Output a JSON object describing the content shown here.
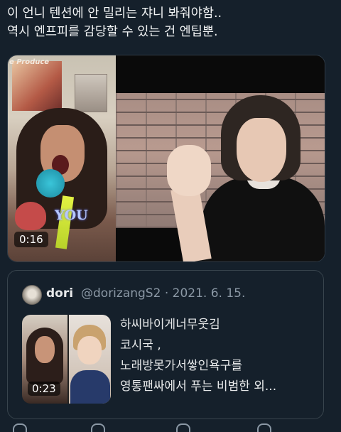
{
  "tweet": {
    "lines": [
      "이 언니 텐션에 안 밀리는 쟈니 봐줘야함..",
      "역시 엔프피를 감당할 수 있는 건 엔팁뿐."
    ]
  },
  "video": {
    "duration": "0:16",
    "overlay_text": "e Produce",
    "sticker_text": "YOU"
  },
  "quote": {
    "name": "dori",
    "handle_date": "@dorizangS2 · 2021. 6. 15.",
    "thumb_duration": "0:23",
    "text_lines": [
      "하씨바이게너무웃김",
      "코시국 ,",
      "노래방못가서쌓인욕구를",
      "영통팬싸에서 푸는 비범한 외..."
    ]
  }
}
